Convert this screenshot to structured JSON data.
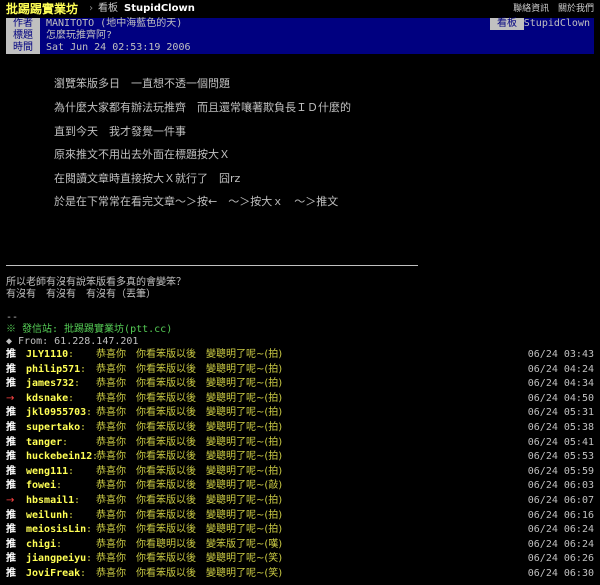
{
  "topbar": {
    "brand": "批踢踢實業坊",
    "separator": "›",
    "board_label": "看板",
    "board_name": "StupidClown",
    "links": [
      "聯絡資訊",
      "關於我們"
    ]
  },
  "meta": {
    "author_key": "作者",
    "author": "MANITOTO (地中海藍色的天)",
    "board_key": "看板",
    "board": "StupidClown",
    "title_key": "標題",
    "title": "怎麼玩推齊阿?",
    "time_key": "時間",
    "time": "Sat Jun 24 02:53:19 2006"
  },
  "content": {
    "lines": [
      "瀏覽笨版多日　一直想不透一個問題",
      "為什麼大家都有辦法玩推齊　而且還常嚷著欺負長ＩＤ什麼的",
      "直到今天　我才發覺一件事",
      "原來推文不用出去外面在標題按大Ｘ",
      "在閱讀文章時直接按大Ｘ就行了　囧rz",
      "於是在下常常在看完文章～＞按←　～＞按大ｘ　～＞推文"
    ],
    "signature": [
      "所以老師有沒有說笨版看多真的會變笨？",
      "有沒有　有沒有　有沒有（丟筆）"
    ],
    "divider": "--",
    "origin": "※ 發信站: 批踢踢實業坊(ptt.cc)",
    "from": "◆ From: 61.228.147.201"
  },
  "pushes": [
    {
      "tag": "推",
      "arrow": false,
      "user": "JLY1110",
      "msg": "恭喜你　你看笨版以後　變聰明了呢~(拍)",
      "time": "06/24 03:43"
    },
    {
      "tag": "推",
      "arrow": false,
      "user": "philip571",
      "msg": "恭喜你　你看笨版以後　變聰明了呢~(拍)",
      "time": "06/24 04:24"
    },
    {
      "tag": "推",
      "arrow": false,
      "user": "james732",
      "msg": "恭喜你　你看笨版以後　變聰明了呢~(拍)",
      "time": "06/24 04:34"
    },
    {
      "tag": "→",
      "arrow": true,
      "user": "kdsnake",
      "msg": "恭喜你　你看笨版以後　變聰明了呢~(拍)",
      "time": "06/24 04:50"
    },
    {
      "tag": "推",
      "arrow": false,
      "user": "jkl0955703",
      "msg": "恭喜你　你看笨版以後　變聰明了呢~(拍)",
      "time": "06/24 05:31"
    },
    {
      "tag": "推",
      "arrow": false,
      "user": "supertako",
      "msg": "恭喜你　你看笨版以後　變聰明了呢~(拍)",
      "time": "06/24 05:38"
    },
    {
      "tag": "推",
      "arrow": false,
      "user": "tanger",
      "msg": "恭喜你　你看笨版以後　變聰明了呢~(拍)",
      "time": "06/24 05:41"
    },
    {
      "tag": "推",
      "arrow": false,
      "user": "huckebein12",
      "msg": "恭喜你　你看笨版以後　變聰明了呢~(拍)",
      "time": "06/24 05:53"
    },
    {
      "tag": "推",
      "arrow": false,
      "user": "weng111",
      "msg": "恭喜你　你看笨版以後　變聰明了呢~(拍)",
      "time": "06/24 05:59"
    },
    {
      "tag": "推",
      "arrow": false,
      "user": "fowei",
      "msg": "恭喜你　你看笨版以後　變聰明了呢~(敲)",
      "time": "06/24 06:03"
    },
    {
      "tag": "→",
      "arrow": true,
      "user": "hbsmail1",
      "msg": "恭喜你　你看笨版以後　變聰明了呢~(拍)",
      "time": "06/24 06:07"
    },
    {
      "tag": "推",
      "arrow": false,
      "user": "weilunh",
      "msg": "恭喜你　你看笨版以後　變聰明了呢~(拍)",
      "time": "06/24 06:16"
    },
    {
      "tag": "推",
      "arrow": false,
      "user": "meiosisLin",
      "msg": "恭喜你　你看笨版以後　變聰明了呢~(拍)",
      "time": "06/24 06:24"
    },
    {
      "tag": "推",
      "arrow": false,
      "user": "chigi",
      "msg": "恭喜你　你看聰明以後　變笨版了呢~(嘆)",
      "time": "06/24 06:24"
    },
    {
      "tag": "推",
      "arrow": false,
      "user": "jiangpeiyu",
      "msg": "恭喜你　你看笨版以後　變聰明了呢~(笑)",
      "time": "06/24 06:26"
    },
    {
      "tag": "推",
      "arrow": false,
      "user": "JoviFreak",
      "msg": "恭喜你　你看笨版以後　變聰明了呢~(笑)",
      "time": "06/24 06:30"
    }
  ]
}
